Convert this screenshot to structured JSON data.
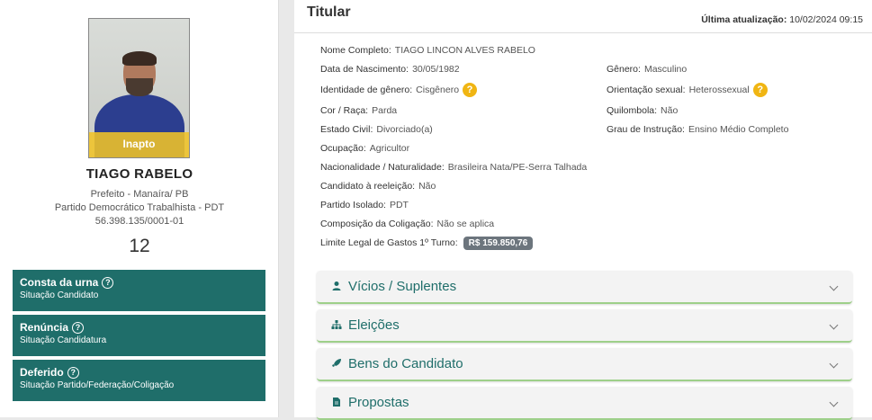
{
  "candidate": {
    "photo_badge": "Inapto",
    "name": "TIAGO RABELO",
    "office": "Prefeito - Manaíra/ PB",
    "party_full": "Partido Democrático Trabalhista - PDT",
    "cnpj": "56.398.135/0001-01",
    "number": "12"
  },
  "statuses": [
    {
      "title": "Consta da urna",
      "subtitle": "Situação Candidato"
    },
    {
      "title": "Renúncia",
      "subtitle": "Situação Candidatura"
    },
    {
      "title": "Deferido",
      "subtitle": "Situação Partido/Federação/Coligação"
    }
  ],
  "header": {
    "title": "Titular",
    "update_label": "Última atualização:",
    "update_value": "10/02/2024 09:15"
  },
  "fields": {
    "nome": {
      "label": "Nome Completo:",
      "value": "TIAGO LINCON ALVES RABELO"
    },
    "nascimento": {
      "label": "Data de Nascimento:",
      "value": "30/05/1982"
    },
    "genero": {
      "label": "Gênero:",
      "value": "Masculino"
    },
    "identidade": {
      "label": "Identidade de gênero:",
      "value": "Cisgênero"
    },
    "orientacao": {
      "label": "Orientação sexual:",
      "value": "Heterossexual"
    },
    "cor": {
      "label": "Cor / Raça:",
      "value": "Parda"
    },
    "quilombola": {
      "label": "Quilombola:",
      "value": "Não"
    },
    "estado_civil": {
      "label": "Estado Civil:",
      "value": "Divorciado(a)"
    },
    "instrucao": {
      "label": "Grau de Instrução:",
      "value": "Ensino Médio Completo"
    },
    "ocupacao": {
      "label": "Ocupação:",
      "value": "Agricultor"
    },
    "nacionalidade": {
      "label": "Nacionalidade / Naturalidade:",
      "value": "Brasileira Nata/PE-Serra Talhada"
    },
    "reeleicao": {
      "label": "Candidato à reeleição:",
      "value": "Não"
    },
    "partido": {
      "label": "Partido Isolado:",
      "value": "PDT"
    },
    "coligacao": {
      "label": "Composição da Coligação:",
      "value": "Não se aplica"
    },
    "limite": {
      "label": "Limite Legal de Gastos 1º Turno:",
      "value": "R$ 159.850,76"
    }
  },
  "help_icon": "?",
  "accordions": [
    {
      "label": "Vícios / Suplentes",
      "icon": "person-icon"
    },
    {
      "label": "Eleições",
      "icon": "sitemap-icon"
    },
    {
      "label": "Bens do Candidato",
      "icon": "rocket-icon"
    },
    {
      "label": "Propostas",
      "icon": "document-icon"
    }
  ],
  "colors": {
    "teal": "#1f6e6a",
    "help_yellow": "#f0b513",
    "badge_yellow": "#f0c428",
    "accent_green": "#9ed08a"
  }
}
